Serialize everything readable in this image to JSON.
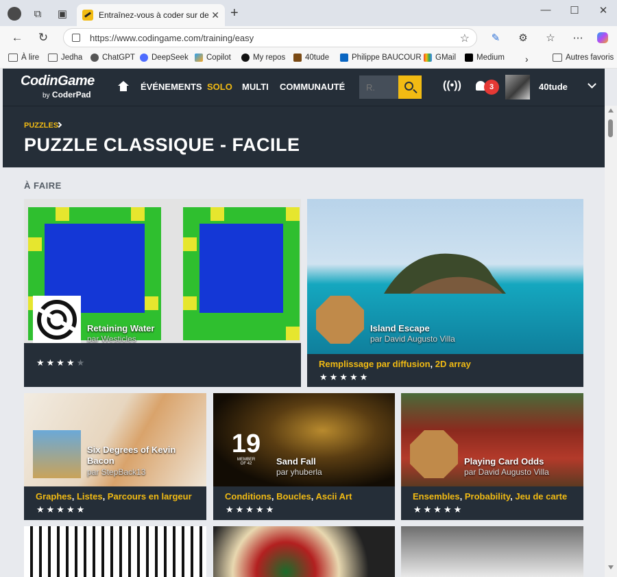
{
  "browser": {
    "tab_title": "Entraînez-vous à coder sur des ch",
    "url": "https://www.codingame.com/training/easy",
    "bookmarks": [
      "À lire",
      "Jedha",
      "ChatGPT",
      "DeepSeek",
      "Copilot",
      "My repos",
      "40tude",
      "Philippe BAUCOUR",
      "GMail",
      "Medium",
      "Autres favoris"
    ]
  },
  "site": {
    "logo_main": "CodinGame",
    "logo_by": "by",
    "logo_sub": "CoderPad",
    "nav": [
      "ÉVÉNEMENTS",
      "SOLO",
      "MULTI",
      "COMMUNAUTÉ"
    ],
    "active_nav": "SOLO",
    "search_placeholder": "R.",
    "notifications": "3",
    "username": "40tude"
  },
  "page": {
    "breadcrumb": "PUZZLES",
    "title": "PUZZLE CLASSIQUE - FACILE",
    "section": "À FAIRE"
  },
  "puzzles": [
    {
      "name": "Retaining Water",
      "author": "par Westicles",
      "tags": [],
      "stars": "★★★★",
      "stars_dim": "★",
      "rating": 4
    },
    {
      "name": "Island Escape",
      "author": "par David Augusto Villa",
      "tags": [
        "Remplissage par diffusion",
        "2D array"
      ],
      "stars": "★★★★★",
      "rating": 5
    },
    {
      "name": "Six Degrees of Kevin Bacon",
      "author": "par StepBack13",
      "tags": [
        "Graphes",
        "Listes",
        "Parcours en largeur"
      ],
      "stars": "★★★★★",
      "rating": 5
    },
    {
      "name": "Sand Fall",
      "author": "par yhuberla",
      "tags": [
        "Conditions",
        "Boucles",
        "Ascii Art"
      ],
      "stars": "★★★★★",
      "rating": 5
    },
    {
      "name": "Playing Card Odds",
      "author": "par David Augusto Villa",
      "tags": [
        "Ensembles",
        "Probability",
        "Jeu de carte"
      ],
      "stars": "★★★★★",
      "rating": 5
    }
  ],
  "sandfall_badge": {
    "number": "19",
    "sub1": "MEMBER",
    "sub2": "OF 42"
  },
  "colors": {
    "accent": "#f2bb13",
    "header": "#252e38",
    "page_bg": "#e8eaee"
  }
}
